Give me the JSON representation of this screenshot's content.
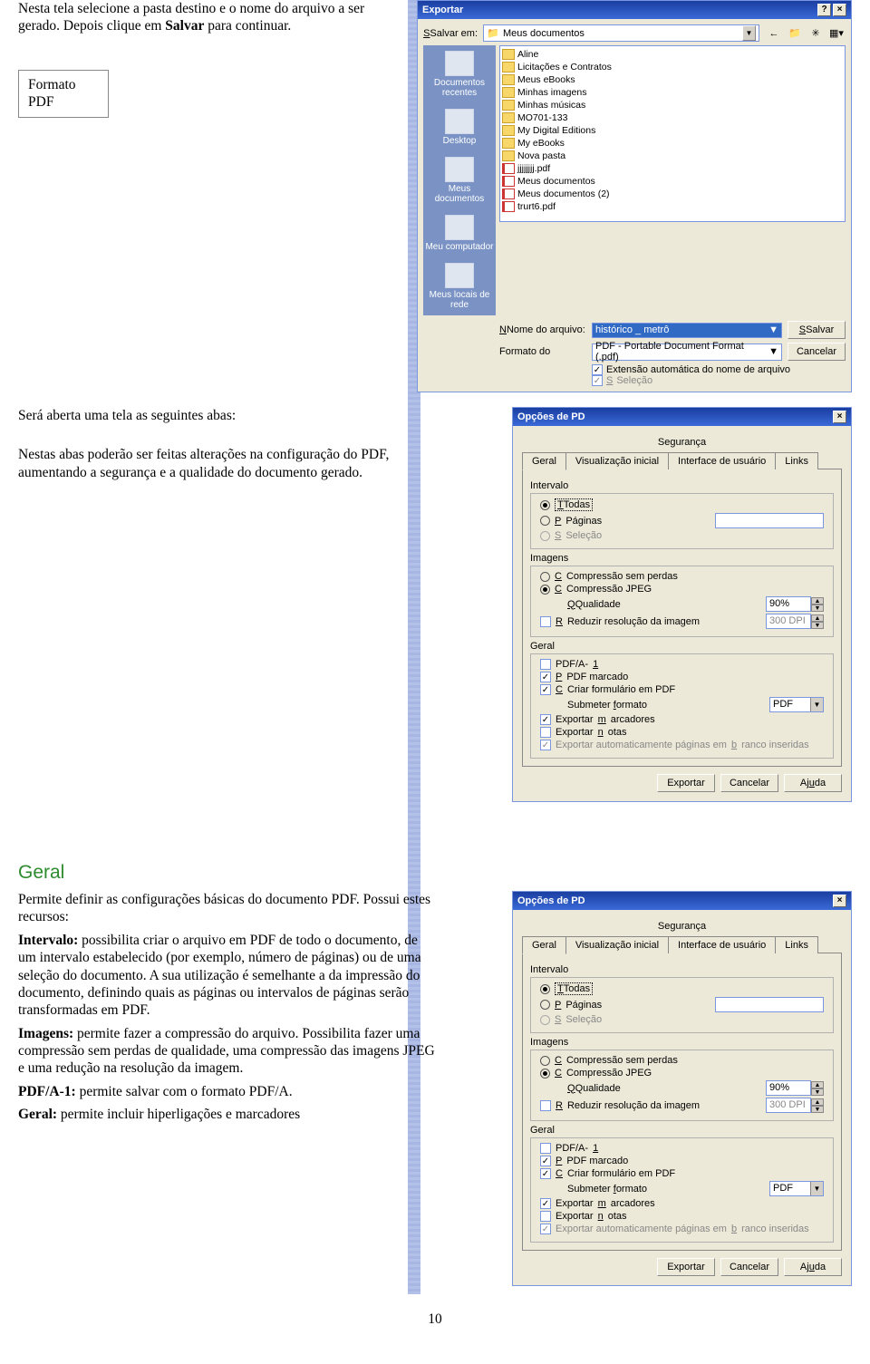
{
  "text": {
    "p1": "Nesta tela selecione a pasta destino e o nome do arquivo a ser gerado. Depois clique em ",
    "p1b": "Salvar",
    "p1c": " para continuar.",
    "boxlabel1": "Formato",
    "boxlabel2": "PDF",
    "p2": "Será aberta uma tela as seguintes abas:",
    "p3": "Nestas abas poderão ser feitas alterações na configuração do PDF, aumentando a segurança e a qualidade do documento gerado.",
    "h_geral": "Geral",
    "p4": "Permite definir as configurações básicas do documento PDF. Possui estes recursos:",
    "t_interv": "Intervalo:",
    "p5": " possibilita criar o arquivo em PDF de todo o documento, de um intervalo estabelecido (por exemplo, número de páginas) ou de uma seleção do documento. A sua utilização é semelhante a da impressão do documento, definindo quais as páginas ou intervalos de páginas serão transformadas em PDF.",
    "t_img": "Imagens:",
    "p6": " permite fazer a compressão do arquivo. Possibilita fazer uma compressão sem perdas de qualidade, uma compressão das imagens JPEG e uma redução na resolução da imagem.",
    "t_pdfa": "PDF/A-1:",
    "p7": " permite salvar com o formato PDF/A.",
    "t_geral": "Geral:",
    "p8": " permite incluir hiperligações e marcadores",
    "page_num": "10"
  },
  "export": {
    "title": "Exportar",
    "salvar_em": "Salvar em:",
    "salvar_em_val": "Meus documentos",
    "places": [
      "Documentos recentes",
      "Desktop",
      "Meus documentos",
      "Meu computador",
      "Meus locais de rede"
    ],
    "files": [
      {
        "t": "folder",
        "n": "Aline"
      },
      {
        "t": "folder",
        "n": "Licitações e Contratos"
      },
      {
        "t": "folder",
        "n": "Meus eBooks"
      },
      {
        "t": "folder",
        "n": "Minhas imagens"
      },
      {
        "t": "folder",
        "n": "Minhas músicas"
      },
      {
        "t": "folder",
        "n": "MO701-133"
      },
      {
        "t": "folder",
        "n": "My Digital Editions"
      },
      {
        "t": "folder",
        "n": "My eBooks"
      },
      {
        "t": "folder",
        "n": "Nova pasta"
      },
      {
        "t": "pdf",
        "n": "jjjjjjjj.pdf"
      },
      {
        "t": "pdf",
        "n": "Meus documentos"
      },
      {
        "t": "pdf",
        "n": "Meus documentos (2)"
      },
      {
        "t": "pdf",
        "n": "trurt6.pdf"
      }
    ],
    "nome_lbl": "Nome do arquivo:",
    "nome_val": "histórico _ metrô",
    "formato_lbl": "Formato do",
    "formato_val": "PDF - Portable Document Format (.pdf)",
    "btn_salvar": "Salvar",
    "btn_cancel": "Cancelar",
    "chk_ext": "Extensão automática do nome de arquivo",
    "chk_sel": "Seleção"
  },
  "opt": {
    "title": "Opções de PD",
    "tab_sec": "Segurança",
    "tabs": [
      "Geral",
      "Visualização inicial",
      "Interface de usuário",
      "Links"
    ],
    "fs_intervalo": "Intervalo",
    "r_todas": "Todas",
    "r_paginas": "Páginas",
    "r_sel": "Seleção",
    "fs_imagens": "Imagens",
    "r_semperdas": "Compressão sem perdas",
    "r_jpeg": "Compressão JPEG",
    "qualidade": "Qualidade",
    "q_val": "90%",
    "reduzir": "Reduzir resolução da imagem",
    "dpi": "300 DPI",
    "fs_geral": "Geral",
    "c_pdfa": "PDF/A-1",
    "c_marcado": "PDF marcado",
    "c_criarform": "Criar formulário em PDF",
    "submeter": "Submeter formato",
    "submeter_val": "PDF",
    "c_expmarc": "Exportar marcadores",
    "c_expnotas": "Exportar notas",
    "c_autopag": "Exportar automaticamente páginas em branco inseridas",
    "btn_export": "Exportar",
    "btn_cancel": "Cancelar",
    "btn_help": "Ajuda"
  }
}
